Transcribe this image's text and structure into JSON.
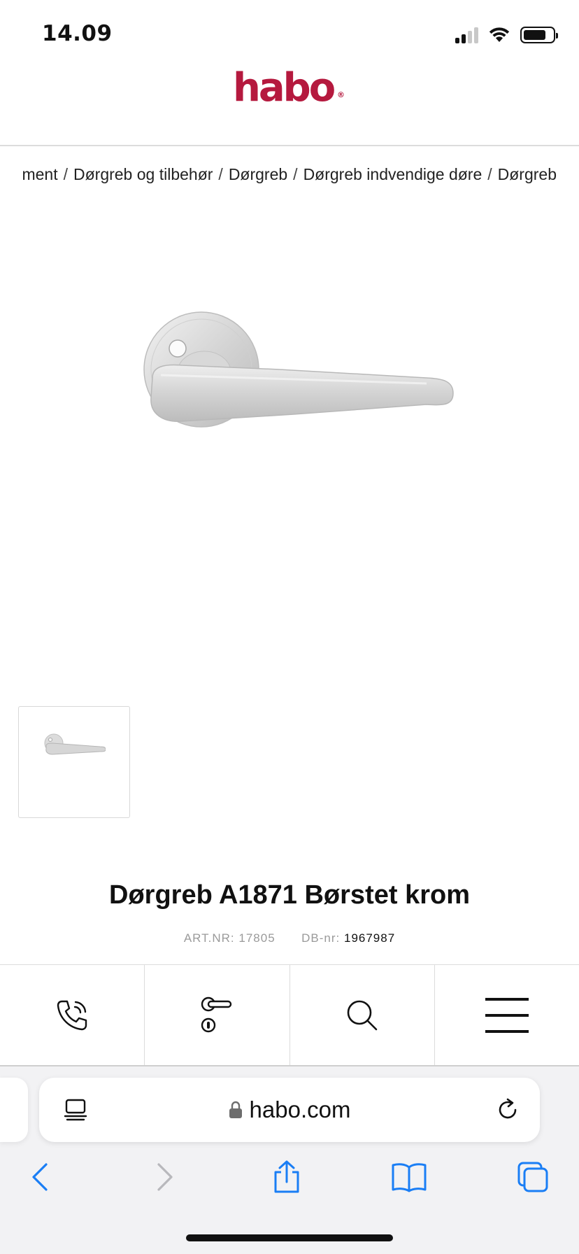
{
  "status_bar": {
    "time": "14.09",
    "signal_bars": 2,
    "battery_level": 0.78
  },
  "header": {
    "logo_text": "habo",
    "logo_color": "#b5193e"
  },
  "breadcrumb": [
    "ment",
    "Dørgreb og tilbehør",
    "Dørgreb",
    "Dørgreb indvendige døre",
    "Dørgreb"
  ],
  "product": {
    "title": "Dørgreb A1871 Børstet krom",
    "art_label": "ART.NR:",
    "art_value": "17805",
    "db_label": "DB-nr:",
    "db_value": "1967987"
  },
  "bottom_nav": [
    {
      "icon": "phone-icon"
    },
    {
      "icon": "door-handle-icon"
    },
    {
      "icon": "search-icon"
    },
    {
      "icon": "menu-icon"
    }
  ],
  "browser": {
    "url": "habo.com",
    "accent": "#1a7ef5"
  }
}
